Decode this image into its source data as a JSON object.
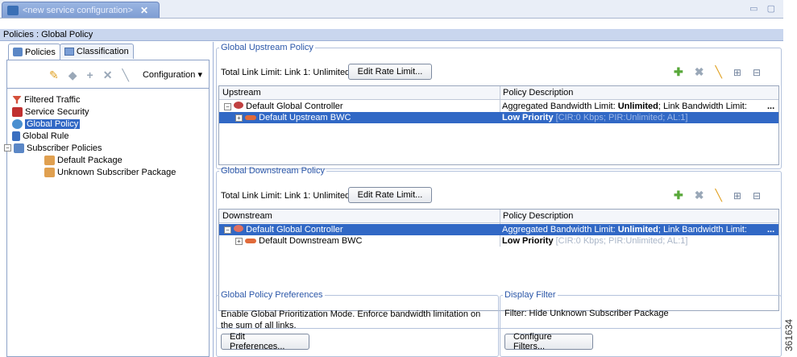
{
  "editor": {
    "title": "<new service configuration>",
    "close_glyph": "✕",
    "window_controls": "▭ ▢"
  },
  "path": "Policies : Global Policy",
  "left": {
    "tabs": [
      {
        "label": "Policies"
      },
      {
        "label": "Classification"
      }
    ],
    "toolbar": {
      "configuration_label": "Configuration ▾"
    },
    "tree": [
      {
        "label": "Filtered Traffic"
      },
      {
        "label": "Service Security"
      },
      {
        "label": "Global Policy"
      },
      {
        "label": "Global Rule"
      },
      {
        "label": "Subscriber Policies"
      },
      {
        "label": "Default Package"
      },
      {
        "label": "Unknown Subscriber Package"
      }
    ]
  },
  "upstream": {
    "legend": "Global Upstream Policy",
    "limit_text": "Total Link Limit:  Link 1: Unlimited",
    "edit_button": "Edit Rate Limit...",
    "col1": "Upstream",
    "col2": "Policy Description",
    "rows": [
      {
        "name": "Default Global Controller",
        "desc_prefix": "Aggregated Bandwidth Limit: ",
        "desc_bold": "Unlimited",
        "desc_suffix": "; Link Bandwidth Limit:",
        "more": "..."
      },
      {
        "name": "Default Upstream BWC",
        "desc_bold": "Low Priority",
        "desc_grey": " [CIR:0 Kbps; PIR:Unlimited; AL:1]"
      }
    ]
  },
  "downstream": {
    "legend": "Global Downstream Policy",
    "limit_text": "Total Link Limit:  Link 1: Unlimited",
    "edit_button": "Edit Rate Limit...",
    "col1": "Downstream",
    "col2": "Policy Description",
    "rows": [
      {
        "name": "Default Global Controller",
        "desc_prefix": "Aggregated Bandwidth Limit: ",
        "desc_bold": "Unlimited",
        "desc_suffix": "; Link Bandwidth Limit:",
        "more": "..."
      },
      {
        "name": "Default Downstream BWC",
        "desc_bold": "Low Priority",
        "desc_grey": " [CIR:0 Kbps; PIR:Unlimited; AL:1]"
      }
    ]
  },
  "prefs": {
    "legend": "Global Policy Preferences",
    "text": "Enable Global Prioritization Mode. Enforce bandwidth limitation on the sum of all links.",
    "button": "Edit Preferences..."
  },
  "filter": {
    "legend": "Display Filter",
    "text": "Filter: Hide Unknown Subscriber Package",
    "button": "Configure Filters..."
  },
  "watermark": "361634"
}
